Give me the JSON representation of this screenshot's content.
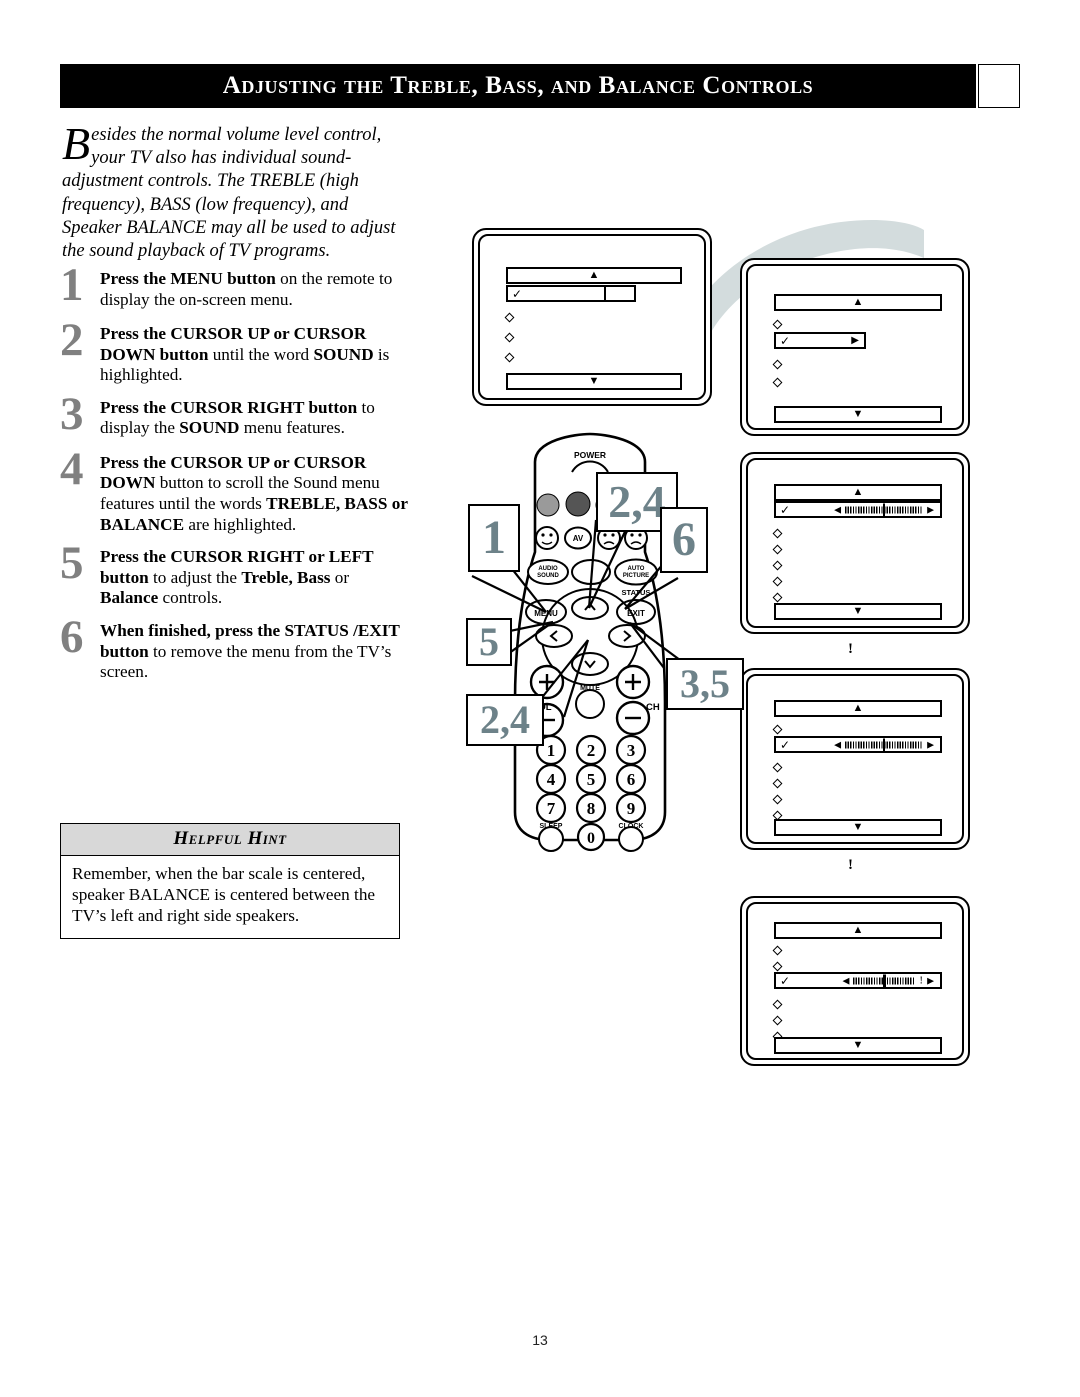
{
  "header": {
    "title": "Adjusting the Treble, Bass, and Balance Controls"
  },
  "intro": {
    "dropcap": "B",
    "text": "esides the normal volume level control, your TV also has individual sound-adjustment controls.  The TREBLE (high frequency), BASS (low frequency), and Speaker BALANCE may all be used to adjust the sound playback of TV programs."
  },
  "steps": [
    {
      "num": "1",
      "html": "<b>Press the MENU button</b> on the remote to display the on-screen menu."
    },
    {
      "num": "2",
      "html": "<b>Press the CURSOR UP or CURSOR DOWN button</b> until the word <b>SOUND</b> is highlighted."
    },
    {
      "num": "3",
      "html": "<b>Press the CURSOR RIGHT button</b> to display the <b>SOUND</b> menu features."
    },
    {
      "num": "4",
      "html": "<b>Press the CURSOR UP or  CURSOR DOWN</b> button to scroll the Sound menu features until the words <b>TREBLE, BASS or BALANCE</b> are highlighted."
    },
    {
      "num": "5",
      "html": "<b>Press the CURSOR RIGHT or LEFT button</b> to adjust the <b>Treble, Bass</b> or <b>Balance</b> controls."
    },
    {
      "num": "6",
      "html": "<b>When finished, press the STATUS /EXIT button</b> to remove the menu from the TV&rsquo;s screen."
    }
  ],
  "hint": {
    "heading": "Helpful Hint",
    "body": "Remember, when the bar scale is centered, speaker BALANCE is centered between the TV’s left and right side speakers."
  },
  "page": {
    "number": "13"
  },
  "colors": {
    "accent": "#6d8289",
    "step_number": "#808080",
    "swoosh": "#d3dcdd",
    "hint_header": "#d8d8d8",
    "header_bar": "#000000"
  },
  "callouts": [
    {
      "id": "callout-1",
      "label": "1"
    },
    {
      "id": "callout-2-4-top",
      "label": "2,4"
    },
    {
      "id": "callout-6",
      "label": "6"
    },
    {
      "id": "callout-5",
      "label": "5"
    },
    {
      "id": "callout-3-5",
      "label": "3,5"
    },
    {
      "id": "callout-2-4-bottom",
      "label": "2,4"
    }
  ],
  "remote": {
    "labels": {
      "power": "POWER",
      "av": "AV",
      "audio_sound": "AUDIO/SOUND",
      "auto_picture": "AUTO PICTURE",
      "status_exit_top": "STATUS",
      "status_exit": "EXIT",
      "menu": "MENU",
      "vol": "VOL",
      "ch": "CH",
      "mute": "MUTE",
      "sleep": "SLEEP",
      "clock": "CLOCK"
    },
    "keypad": [
      "1",
      "2",
      "3",
      "4",
      "5",
      "6",
      "7",
      "8",
      "9",
      "0"
    ]
  },
  "screens": [
    {
      "id": "screen-menu-main",
      "separator": "",
      "rows": [
        {
          "type": "bar",
          "glyph": "▲"
        },
        {
          "type": "highlight",
          "check": "✓",
          "glyph": "▶",
          "shadow": true
        },
        {
          "type": "diamond"
        },
        {
          "type": "diamond"
        },
        {
          "type": "diamond"
        },
        {
          "type": "bar",
          "glyph": "▼"
        }
      ]
    },
    {
      "id": "screen-sound-selected",
      "separator": "",
      "rows": [
        {
          "type": "bar",
          "glyph": "▲"
        },
        {
          "type": "diamond"
        },
        {
          "type": "highlight",
          "check": "✓",
          "glyph": "▶",
          "shadow": false
        },
        {
          "type": "diamond"
        },
        {
          "type": "diamond"
        },
        {
          "type": "bar",
          "glyph": "▼"
        }
      ]
    },
    {
      "id": "screen-treble-scale",
      "separator": "!",
      "rows": [
        {
          "type": "bar",
          "glyph": "▲"
        },
        {
          "type": "scale",
          "check": "✓",
          "left": "◀",
          "right": "▶",
          "position": 50,
          "mark": ""
        },
        {
          "type": "diamond"
        },
        {
          "type": "diamond"
        },
        {
          "type": "diamond"
        },
        {
          "type": "diamond"
        },
        {
          "type": "diamond"
        },
        {
          "type": "bar",
          "glyph": "▼"
        }
      ]
    },
    {
      "id": "screen-bass-scale",
      "separator": "!",
      "rows": [
        {
          "type": "bar",
          "glyph": "▲"
        },
        {
          "type": "diamond"
        },
        {
          "type": "scale",
          "check": "✓",
          "left": "◀",
          "right": "▶",
          "position": 50,
          "mark": ""
        },
        {
          "type": "diamond"
        },
        {
          "type": "diamond"
        },
        {
          "type": "diamond"
        },
        {
          "type": "diamond"
        },
        {
          "type": "bar",
          "glyph": "▼"
        }
      ]
    },
    {
      "id": "screen-balance-scale",
      "separator": "",
      "rows": [
        {
          "type": "bar",
          "glyph": "▲"
        },
        {
          "type": "diamond"
        },
        {
          "type": "diamond"
        },
        {
          "type": "scale",
          "check": "✓",
          "left": "◀",
          "right": "▶",
          "position": 50,
          "mark": "!"
        },
        {
          "type": "diamond"
        },
        {
          "type": "diamond"
        },
        {
          "type": "diamond"
        },
        {
          "type": "bar",
          "glyph": "▼"
        }
      ]
    }
  ]
}
